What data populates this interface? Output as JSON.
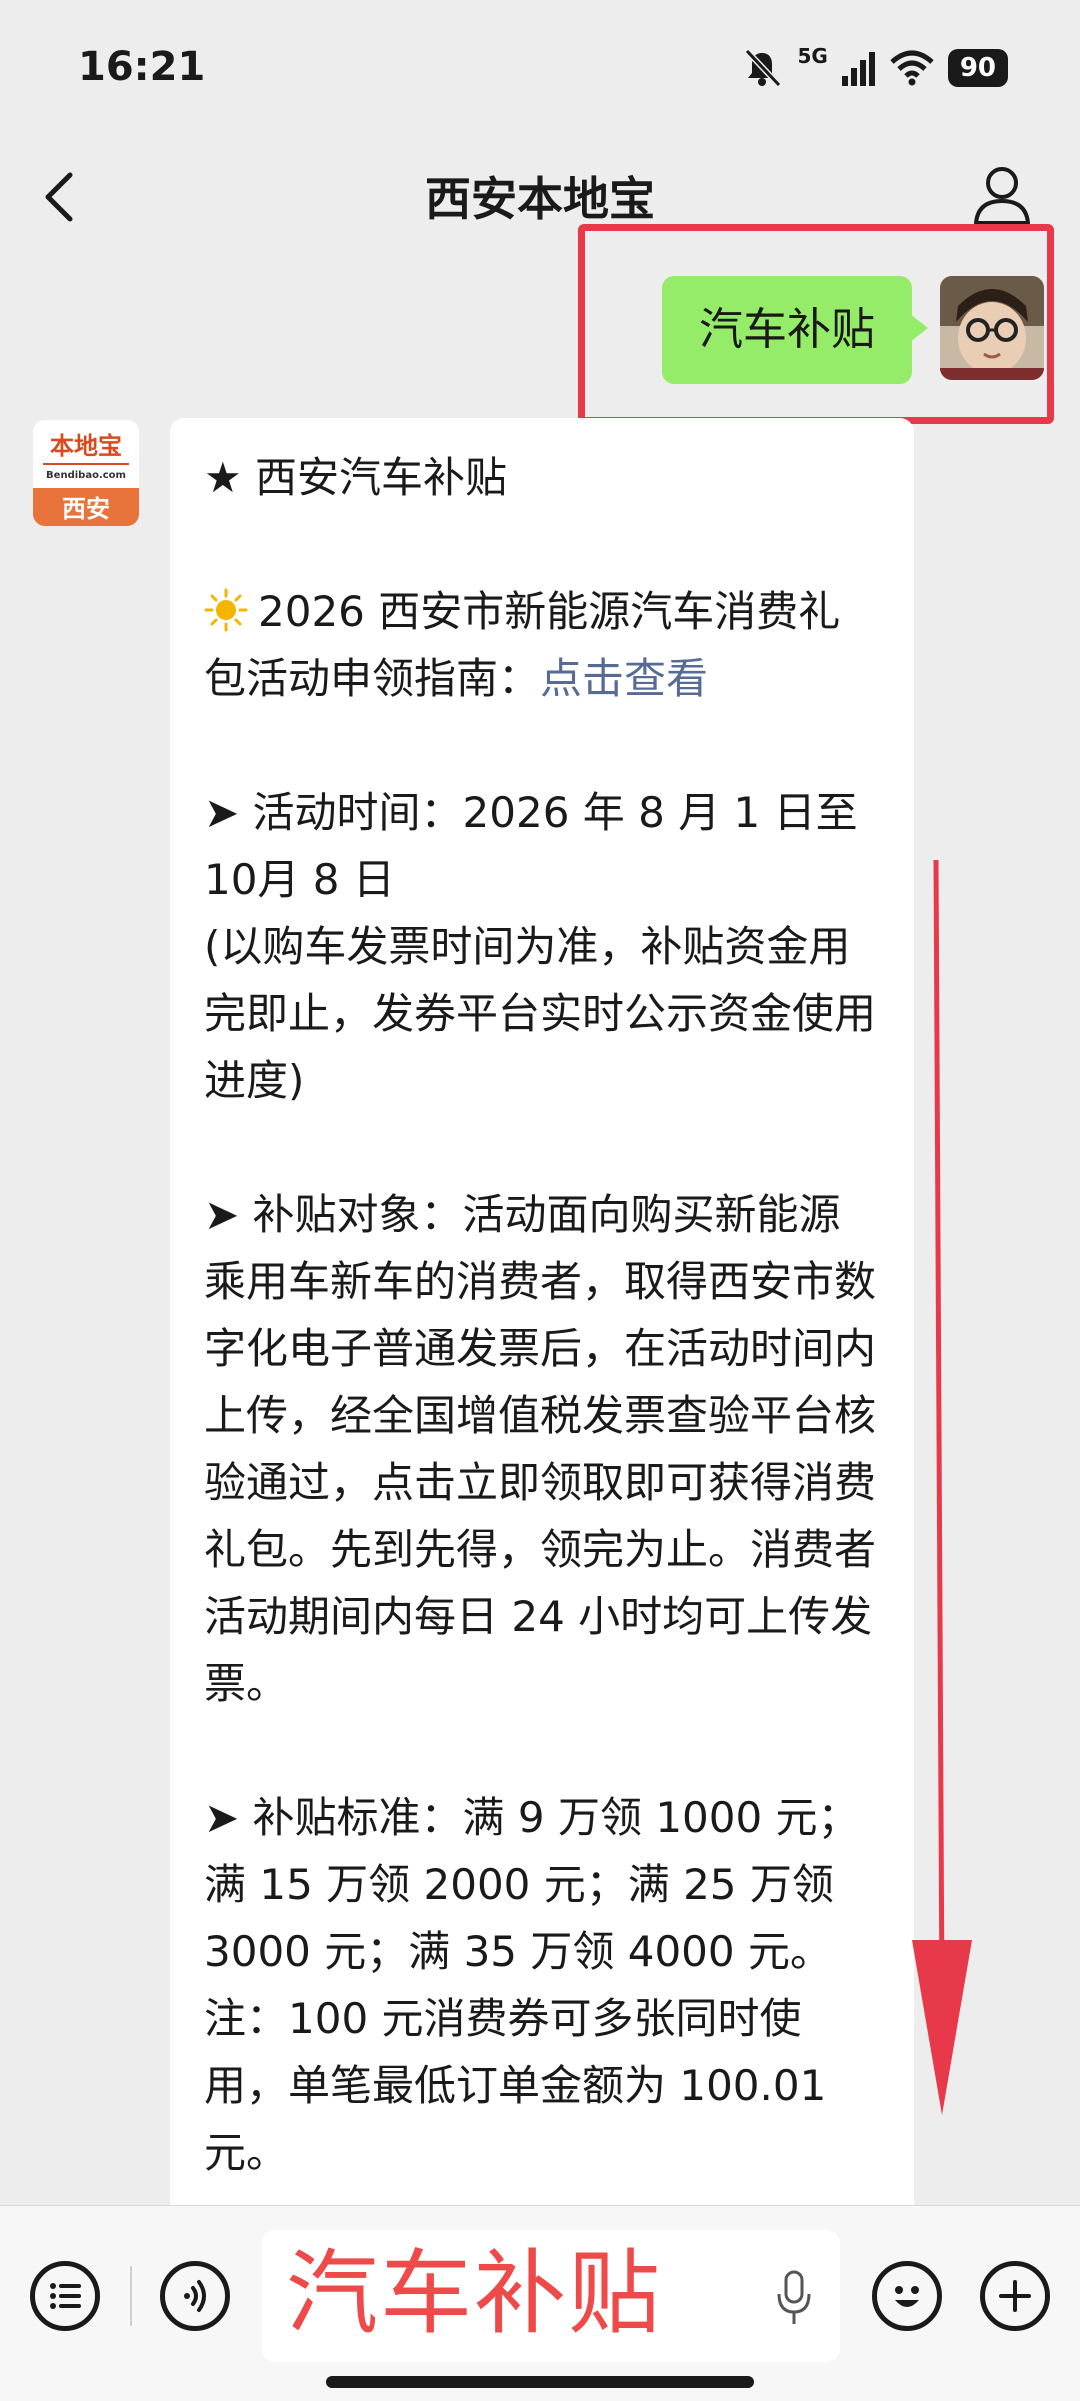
{
  "status_bar": {
    "time": "16:21",
    "network": "5G",
    "battery": "90"
  },
  "nav": {
    "title": "西安本地宝"
  },
  "chat": {
    "sent_message": "汽车补贴",
    "bot_avatar": {
      "brand": "本地宝",
      "site": "Bendibao.com",
      "city": "西安"
    },
    "reply": {
      "heading": "★ 西安汽车补贴",
      "guide_text": "2026 西安市新能源汽车消费礼包活动申领指南：",
      "guide_link": "点击查看",
      "time_title": "➤ 活动时间：2026 年 8 月 1 日至 10月 8 日",
      "time_note": "(以购车发票时间为准，补贴资金用完即止，发券平台实时公示资金使用进度)",
      "target": "➤ 补贴对象：活动面向购买新能源乘用车新车的消费者，取得西安市数字化电子普通发票后，在活动时间内上传，经全国增值税发票查验平台核验通过，点击立即领取即可获得消费礼包。先到先得，领完为止。消费者活动期间内每日 24 小时均可上传发票。",
      "standard": "➤ 补贴标准：满 9 万领 1000 元；满 15 万领 2000 元；满 25 万领 3000 元；满 35 万领 4000 元。",
      "note": "注：100 元消费券可多张同时使用，单笔最低订单金额为 100.01 元。"
    }
  },
  "input_bar": {
    "text": "汽车补贴"
  },
  "colors": {
    "accent_red": "#e8394b",
    "bubble_green": "#95ec69",
    "link_blue": "#576b95"
  },
  "icons": [
    "back-arrow-icon",
    "profile-icon",
    "menu-list-icon",
    "voice-icon",
    "microphone-icon",
    "emoji-icon",
    "plus-icon",
    "sun-icon",
    "down-arrow-icon"
  ]
}
